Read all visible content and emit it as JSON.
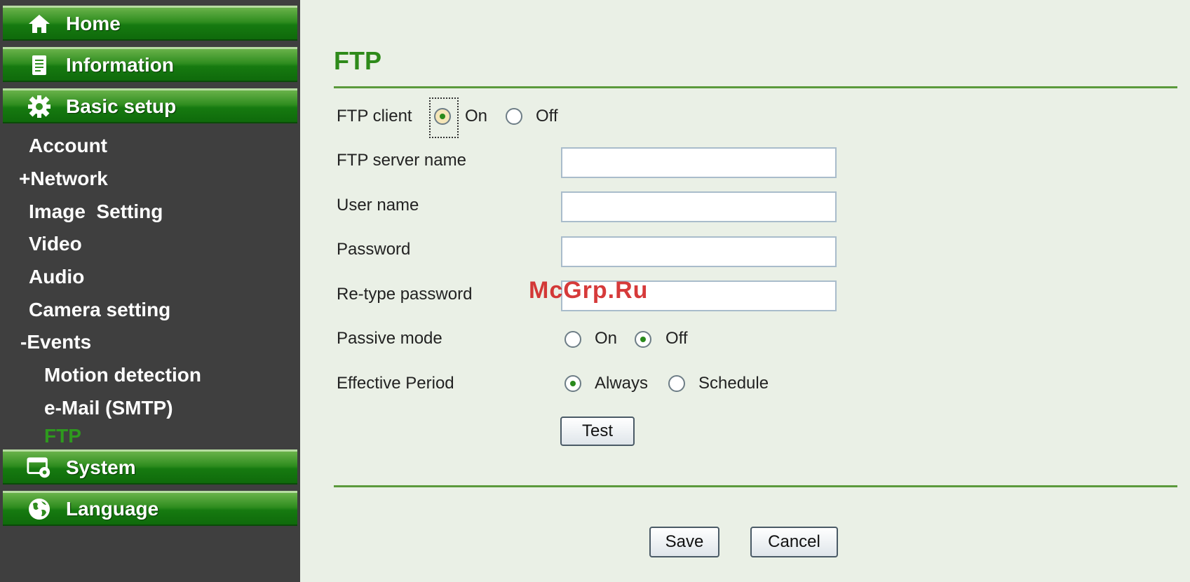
{
  "sidebar": {
    "top_items": [
      {
        "label": "Home",
        "icon": "home-icon"
      },
      {
        "label": "Information",
        "icon": "document-icon"
      },
      {
        "label": "Basic setup",
        "icon": "gear-icon"
      }
    ],
    "sub_items": [
      {
        "label": "Account"
      },
      {
        "label": "+Network"
      },
      {
        "label": "Image  Setting"
      },
      {
        "label": "Video"
      },
      {
        "label": "Audio"
      },
      {
        "label": "Camera setting"
      },
      {
        "label": "-Events"
      },
      {
        "label": "Motion detection"
      },
      {
        "label": "e-Mail (SMTP)"
      },
      {
        "label": "FTP"
      }
    ],
    "bottom_items": [
      {
        "label": "System",
        "icon": "system-icon"
      },
      {
        "label": "Language",
        "icon": "globe-icon"
      }
    ],
    "active_item": "FTP"
  },
  "main": {
    "title": "FTP",
    "ftp_client": {
      "label": "FTP client",
      "on": "On",
      "off": "Off",
      "selected": "On"
    },
    "ftp_server_name": {
      "label": "FTP server name",
      "value": ""
    },
    "user_name": {
      "label": "User name",
      "value": ""
    },
    "password": {
      "label": "Password",
      "value": ""
    },
    "retype_password": {
      "label": "Re-type password",
      "value": ""
    },
    "passive_mode": {
      "label": "Passive mode",
      "on": "On",
      "off": "Off",
      "selected": "Off"
    },
    "effective_period": {
      "label": "Effective Period",
      "always": "Always",
      "schedule": "Schedule",
      "selected": "Always"
    },
    "test_button": "Test",
    "save_button": "Save",
    "cancel_button": "Cancel"
  },
  "watermark": "McGrp.Ru",
  "colors": {
    "accent_green": "#2e8a1a",
    "sidebar_bg": "#3f3f3f",
    "page_bg": "#eaf0e6",
    "active_menu": "#2e9a1e"
  }
}
